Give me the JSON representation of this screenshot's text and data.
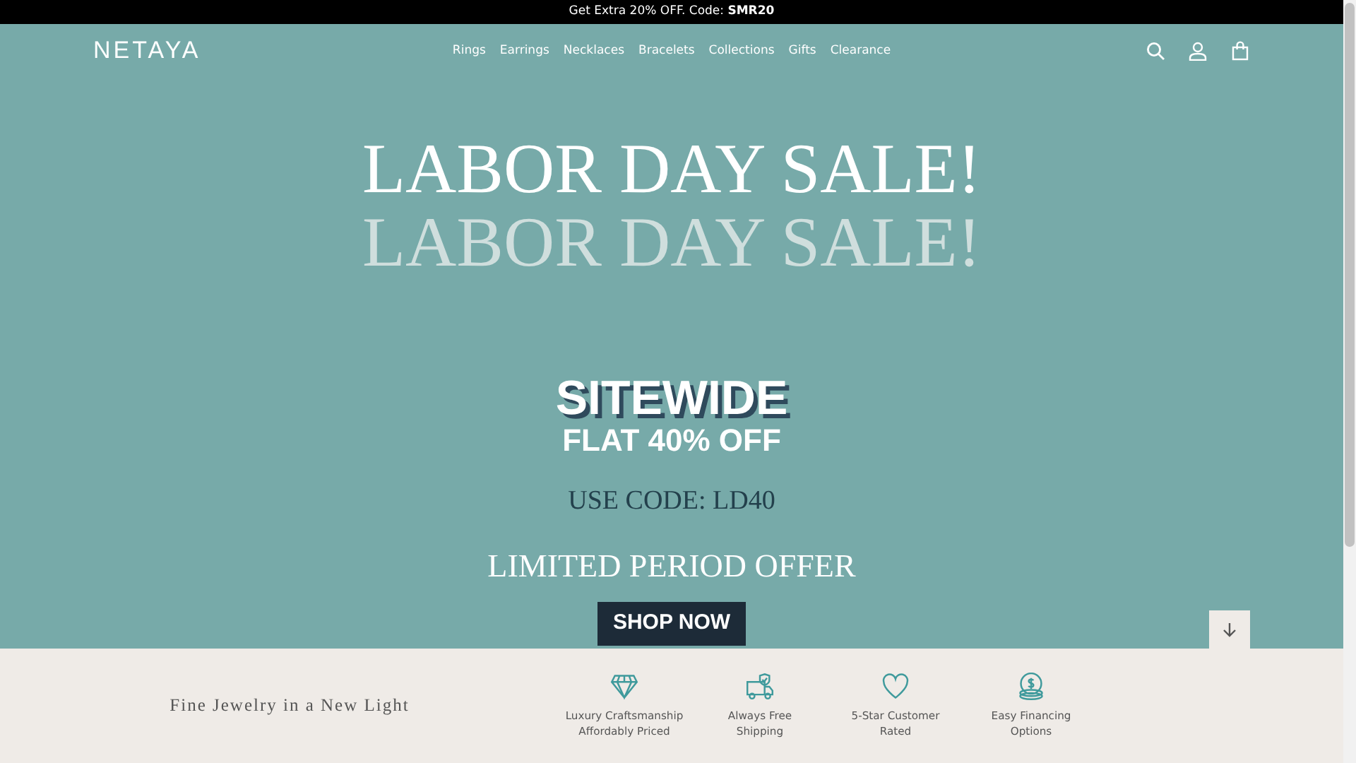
{
  "announcement": "Get Extra 20% OFF. Code: **SMR20**",
  "logo": "NETAYA",
  "nav": [
    {
      "label": "Rings"
    },
    {
      "label": "Earrings"
    },
    {
      "label": "Necklaces"
    },
    {
      "label": "Bracelets"
    },
    {
      "label": "Collections"
    },
    {
      "label": "Gifts"
    },
    {
      "label": "Clearance"
    }
  ],
  "hero": {
    "headline": "LABOR DAY SALE!",
    "headline_echo": "LABOR DAY SALE!",
    "sitewide": "SITEWIDE",
    "discount": "FLAT 40% OFF",
    "code": "USE CODE: LD40",
    "offer": "LIMITED PERIOD OFFER",
    "button": "SHOP NOW"
  },
  "tagline": "Fine Jewelry in a New Light",
  "features": [
    {
      "kind": "diamond",
      "lines": [
        "Luxury Craftsmanship",
        "Affordably Priced"
      ]
    },
    {
      "kind": "truck",
      "lines": [
        "Always Free",
        "Shipping"
      ]
    },
    {
      "kind": "heart",
      "lines": [
        "5-Star Customer",
        "Rated"
      ]
    },
    {
      "kind": "coins",
      "lines": [
        "Easy Financing",
        "Options"
      ]
    }
  ]
}
